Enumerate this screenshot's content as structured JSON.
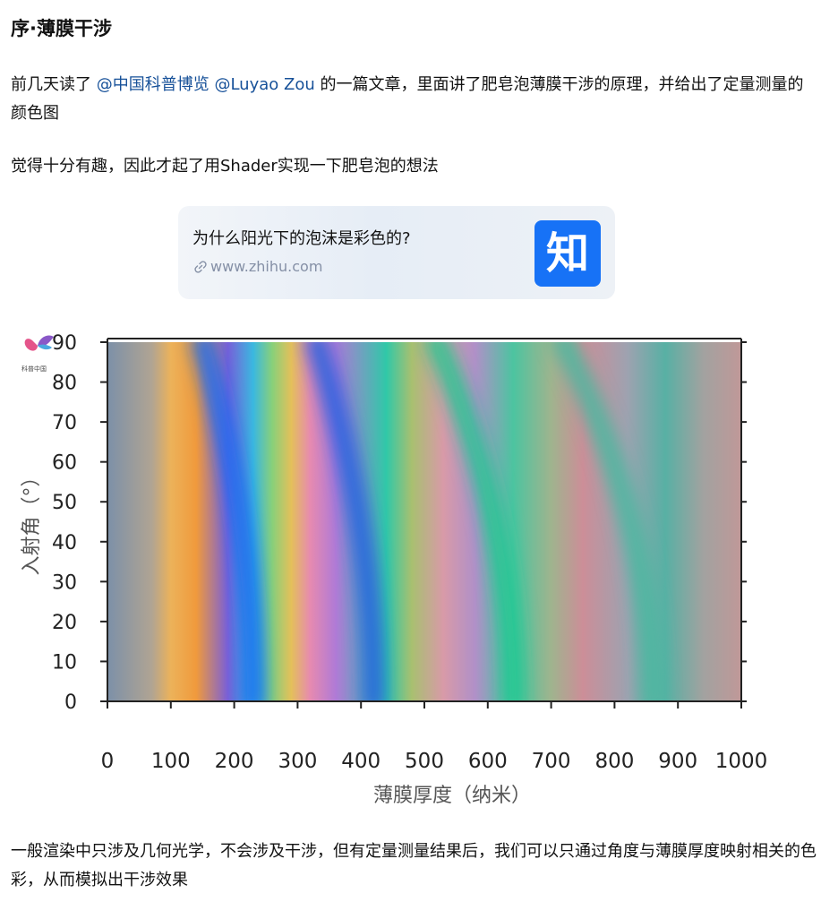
{
  "article": {
    "title": "序·薄膜干涉",
    "p1_before": "前几天读了 ",
    "mention1": "@中国科普博览",
    "p1_space": " ",
    "mention2": "@Luyao Zou",
    "p1_after": " 的一篇文章，里面讲了肥皂泡薄膜干涉的原理，并给出了定量测量的颜色图",
    "p2": "觉得十分有趣，因此才起了用Shader实现一下肥皂泡的想法",
    "p3": "一般渲染中只涉及几何光学，不会涉及干涉，但有定量测量结果后，我们可以只通过角度与薄膜厚度映射相关的色彩，从而模拟出干涉效果"
  },
  "link_card": {
    "title": "为什么阳光下的泡沫是彩色的?",
    "url": "www.zhihu.com",
    "logo_char": "知",
    "logo_color": "#1772f6"
  },
  "chart_data": {
    "type": "heatmap",
    "title": "",
    "xlabel": "薄膜厚度（纳米）",
    "ylabel": "入射角（°）",
    "xlim": [
      0,
      1000
    ],
    "ylim": [
      0,
      90
    ],
    "x_ticks": [
      "0",
      "100",
      "200",
      "300",
      "400",
      "500",
      "600",
      "700",
      "800",
      "900",
      "1000"
    ],
    "y_ticks": [
      "0",
      "10",
      "20",
      "30",
      "40",
      "50",
      "60",
      "70",
      "80",
      "90"
    ],
    "color_bands": [
      {
        "thickness_at_0deg": 230,
        "thickness_at_90deg": 150,
        "color": "#1a6cf0"
      },
      {
        "thickness_at_0deg": 420,
        "thickness_at_90deg": 330,
        "color": "#2560e0"
      },
      {
        "thickness_at_0deg": 640,
        "thickness_at_90deg": 520,
        "color": "#20c890"
      },
      {
        "thickness_at_0deg": 860,
        "thickness_at_90deg": 720,
        "color": "#48b8a0"
      }
    ],
    "watermark": "科普中国"
  }
}
